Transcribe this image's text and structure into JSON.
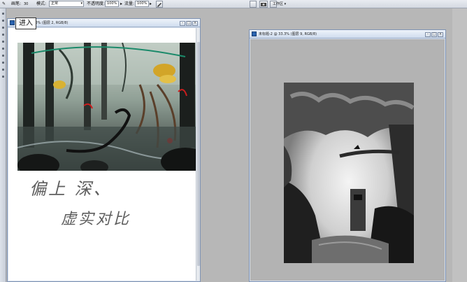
{
  "options_bar": {
    "brush_label": "画笔:",
    "brush_size": "30",
    "mode_label": "模式:",
    "mode_value": "正常",
    "opacity_label": "不透明度:",
    "opacity_value": "100%",
    "flow_label": "流量:",
    "flow_value": "100%",
    "workspace_label": "工作区 ▾"
  },
  "tooltip": {
    "text": "进入"
  },
  "left_window": {
    "title": "未标题 @ 50% (图层 2, RGB/8)",
    "handwriting_line1": "偏上 深、",
    "handwriting_line2": "虚实对比"
  },
  "right_window": {
    "title": "未标题-2 @ 33.3% (图层 9, RGB/8)"
  },
  "colors": {
    "app_bg": "#b7b7b7",
    "title_gradient_top": "#eef3fa",
    "accent": "#2a63b0"
  }
}
